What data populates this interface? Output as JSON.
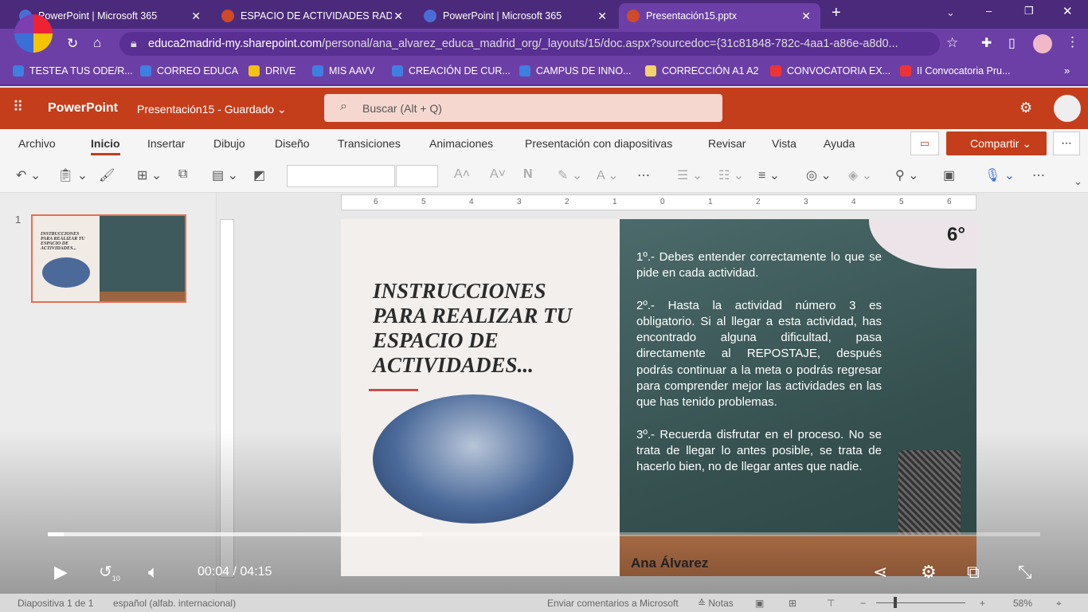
{
  "browser": {
    "tabs": [
      {
        "title": "PowerPoint | Microsoft 365",
        "active": false
      },
      {
        "title": "ESPACIO DE ACTIVIDADES RADIO",
        "active": false
      },
      {
        "title": "PowerPoint | Microsoft 365",
        "active": false
      },
      {
        "title": "Presentación15.pptx",
        "active": true
      }
    ],
    "url_domain": "educa2madrid-my.sharepoint.com",
    "url_path": "/personal/ana_alvarez_educa_madrid_org/_layouts/15/doc.aspx?sourcedoc={31c81848-782c-4aa1-a86e-a8d0...",
    "bookmarks": [
      "TESTEA TUS ODE/R...",
      "CORREO EDUCA",
      "DRIVE",
      "MIS AAVV",
      "CREACIÓN DE CUR...",
      "CAMPUS DE INNO...",
      "CORRECCIÓN A1 A2",
      "CONVOCATORIA EX...",
      "II Convocatoria Pru..."
    ],
    "accent": "#6c3fa6"
  },
  "app": {
    "name": "PowerPoint",
    "doc_title": "Presentación15",
    "save_status": "Guardado",
    "search_placeholder": "Buscar (Alt + Q)",
    "accent": "#c43e1c",
    "ribbon_tabs": [
      "Archivo",
      "Inicio",
      "Insertar",
      "Dibujo",
      "Diseño",
      "Transiciones",
      "Animaciones",
      "Presentación con diapositivas",
      "Revisar",
      "Vista",
      "Ayuda"
    ],
    "selected_tab": "Inicio",
    "share_label": "Compartir"
  },
  "thumbnails": [
    {
      "number": "1"
    }
  ],
  "ruler": [
    "6",
    "5",
    "4",
    "3",
    "2",
    "1",
    "0",
    "1",
    "2",
    "3",
    "4",
    "5",
    "6"
  ],
  "slide": {
    "title": "INSTRUCCIONES PARA REALIZAR TU ESPACIO DE ACTIVIDADES...",
    "grade": "6°",
    "paragraphs": [
      "1º.- Debes entender correctamente lo que se pide en cada actividad.",
      "2º.- Hasta la actividad número 3 es obligatorio. Si al llegar a esta actividad, has encontrado alguna dificultad, pasa directamente al REPOSTAJE, después podrás continuar a la meta o podrás regresar para comprender mejor las actividades en las que has tenido problemas.",
      "3º.- Recuerda disfrutar en el proceso. No se trata de llegar lo antes posible, se trata de hacerlo bien, no de llegar antes que nadie."
    ],
    "author": "Ana Álvarez"
  },
  "video": {
    "current": "00:04",
    "separator": "/",
    "duration": "04:15",
    "played_fraction": 0.016,
    "buffered_fraction": 0.377,
    "rewind_seconds": "10"
  },
  "status": {
    "slide_info": "Diapositiva 1 de 1",
    "language": "español (alfab. internacional)",
    "feedback": "Enviar comentarios a Microsoft",
    "notes": "Notas",
    "zoom": "58%"
  }
}
